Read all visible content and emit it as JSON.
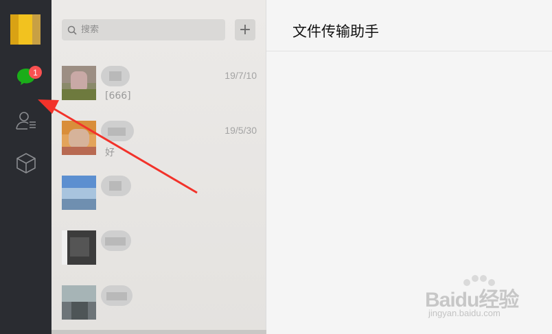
{
  "sidebar": {
    "unread_badge": "1",
    "icons": [
      "chat-icon",
      "contacts-icon",
      "box-icon"
    ],
    "accent": "#1aad19",
    "badge_color": "#fa5151"
  },
  "search": {
    "placeholder": "搜索",
    "add_label": "+"
  },
  "chats": [
    {
      "time": "19/7/10",
      "preview": "[666]"
    },
    {
      "time": "19/5/30",
      "preview": "好"
    },
    {
      "time": "",
      "preview": ""
    },
    {
      "time": "",
      "preview": ""
    },
    {
      "time": "",
      "preview": ""
    }
  ],
  "main": {
    "title": "文件传输助手"
  },
  "watermark": {
    "logo": "Baidu经验",
    "url": "jingyan.baidu.com"
  }
}
